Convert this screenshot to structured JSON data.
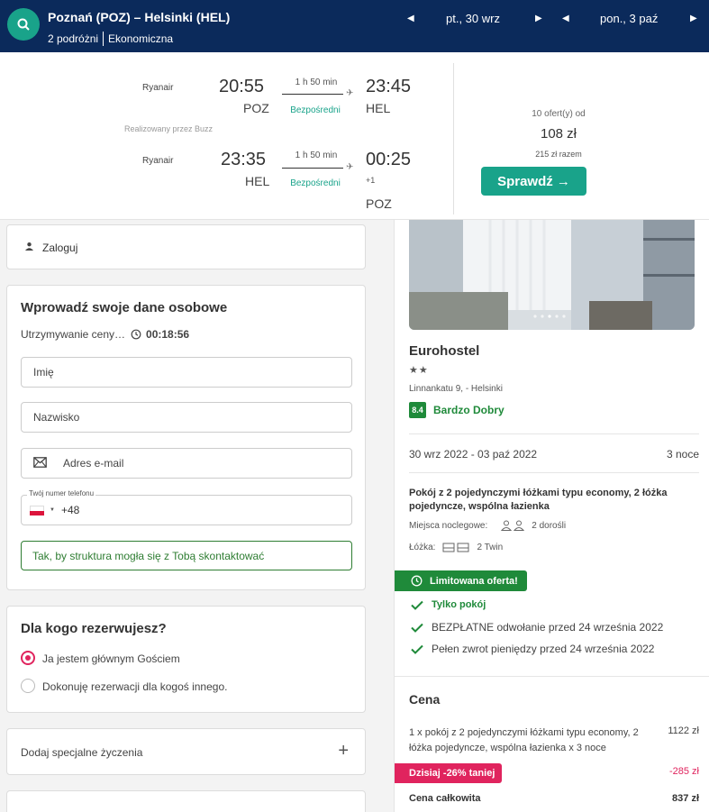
{
  "header": {
    "route": "Poznań (POZ) – Helsinki (HEL)",
    "travelers": "2 podróżni",
    "cabin": "Ekonomiczna",
    "outbound_date": "pt., 30 wrz",
    "return_date": "pon., 3 paź"
  },
  "flights": {
    "outbound": {
      "airline": "Ryanair",
      "dep_time": "20:55",
      "dep_airport": "POZ",
      "duration": "1 h 50 min",
      "stops": "Bezpośredni",
      "arr_time": "23:45",
      "arr_airport": "HEL"
    },
    "operated_by": "Realizowany przez Buzz",
    "return": {
      "airline": "Ryanair",
      "dep_time": "23:35",
      "dep_airport": "HEL",
      "duration": "1 h 50 min",
      "stops": "Bezpośredni",
      "arr_time": "00:25",
      "day_offset": "+1",
      "arr_airport": "POZ"
    },
    "offers": "10 ofert(y) od",
    "price": "108 zł",
    "total": "215 zł razem",
    "check_label": "Sprawdź →"
  },
  "login": {
    "label": "Zaloguj"
  },
  "personal": {
    "title": "Wprowadź swoje dane osobowe",
    "hold_label": "Utrzymywanie ceny…",
    "timer": "00:18:56",
    "first_name_placeholder": "Imię",
    "last_name_placeholder": "Nazwisko",
    "email_placeholder": "Adres e-mail",
    "phone_legend": "Twój numer telefonu",
    "phone_prefix": "+48",
    "hint": "Tak, by struktura mogła się z Tobą skontaktować"
  },
  "whom": {
    "title": "Dla kogo rezerwujesz?",
    "option_main": "Ja jestem głównym Gościem",
    "option_other": "Dokonuję rezerwacji dla kogoś innego."
  },
  "special": {
    "label": "Dodaj specjalne życzenia"
  },
  "hotel": {
    "name": "Eurohostel",
    "stars": "★★",
    "address": "Linnankatu 9, - Helsinki",
    "score": "8.4",
    "rating_text": "Bardzo Dobry",
    "dates": "30 wrz 2022 - 03 paź 2022",
    "nights": "3 noce",
    "room": "Pokój z 2 pojedynczymi łóżkami typu economy, 2 łóżka pojedyncze, wspólna łazienka",
    "sleeps_label": "Miejsca noclegowe:",
    "sleeps_value": "2 dorośli",
    "beds_label": "Łóżka:",
    "beds_value": "2 Twin",
    "limited": "Limitowana oferta!",
    "perk_room_only": "Tylko pokój",
    "perk_cancel": "BEZPŁATNE odwołanie przed 24 września 2022",
    "perk_refund": "Pełen zwrot pieniędzy przed 24 września 2022"
  },
  "price": {
    "title": "Cena",
    "desc": "1 x pokój z 2 pojedynczymi łóżkami typu economy, 2 łóżka pojedyncze, wspólna łazienka x 3 noce",
    "value": "1122 zł",
    "discount_label": "Dzisiaj -26% taniej",
    "discount_value": "-285 zł",
    "total_label": "Cena całkowita",
    "total_value": "837 zł"
  },
  "colors": {
    "header_bg": "#0b2a5b",
    "accent_teal": "#19a38a",
    "green": "#1f8a3a",
    "pink": "#e0245e"
  },
  "icons": [
    "search-icon",
    "left-arrow-icon",
    "right-arrow-icon",
    "plane-icon",
    "user-icon",
    "clock-icon",
    "envelope-icon",
    "check-icon",
    "person-icon",
    "bed-icon",
    "plus-icon"
  ]
}
